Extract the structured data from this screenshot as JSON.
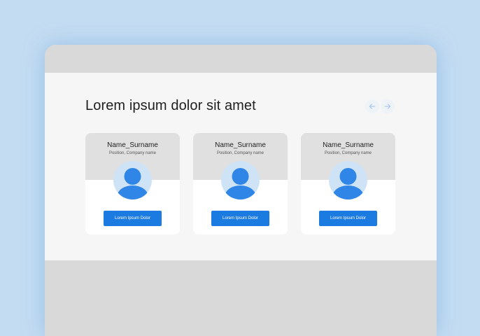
{
  "section": {
    "title": "Lorem ipsum dolor sit amet"
  },
  "nav": {
    "prev_icon": "arrow-left-icon",
    "next_icon": "arrow-right-icon"
  },
  "cards": [
    {
      "name": "Name_Surname",
      "position": "Position, Company name",
      "button_label": "Lorem Ipsum Dolor"
    },
    {
      "name": "Name_Surname",
      "position": "Position, Company name",
      "button_label": "Lorem Ipsum Dolor"
    },
    {
      "name": "Name_Surname",
      "position": "Position, Company name",
      "button_label": "Lorem Ipsum Dolor"
    }
  ],
  "colors": {
    "background": "#c3dcf2",
    "window": "#d9d9d9",
    "panel": "#f6f6f6",
    "card_top": "#e0e0e0",
    "avatar_bg": "#cfe3f7",
    "avatar_figure": "#2f86e6",
    "button": "#1c7be0",
    "arrow": "#9cc3ec"
  }
}
